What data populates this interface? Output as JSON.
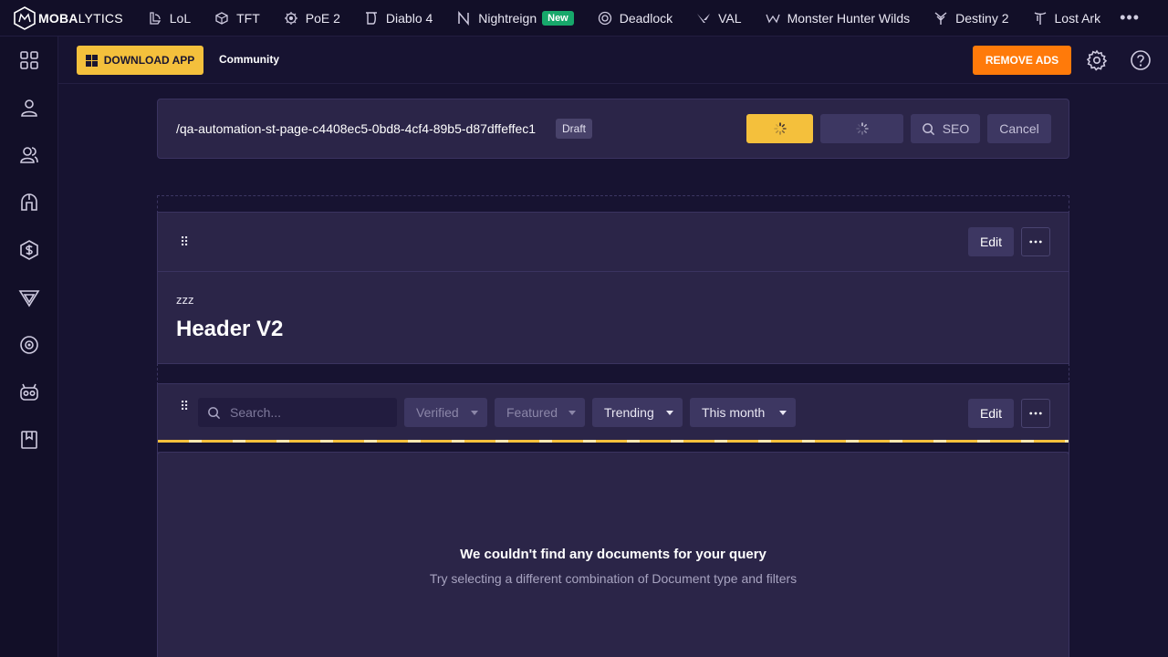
{
  "brand": {
    "bold": "MOBA",
    "light": "LYTICS"
  },
  "games": [
    {
      "label": "LoL",
      "icon": "lol-icon"
    },
    {
      "label": "TFT",
      "icon": "tft-icon"
    },
    {
      "label": "PoE 2",
      "icon": "poe2-icon"
    },
    {
      "label": "Diablo 4",
      "icon": "diablo4-icon"
    },
    {
      "label": "Nightreign",
      "icon": "nightreign-icon",
      "badge": "New"
    },
    {
      "label": "Deadlock",
      "icon": "deadlock-icon"
    },
    {
      "label": "VAL",
      "icon": "valorant-icon"
    },
    {
      "label": "Monster Hunter Wilds",
      "icon": "monster-hunter-icon"
    },
    {
      "label": "Destiny 2",
      "icon": "destiny2-icon"
    },
    {
      "label": "Lost Ark",
      "icon": "lost-ark-icon"
    }
  ],
  "more": "•••",
  "sidebar": [
    "apps-grid-icon",
    "profile-icon",
    "friends-icon",
    "helmet-icon",
    "coin-icon",
    "tft-icon",
    "target-icon",
    "robot-icon",
    "bookmark-icon"
  ],
  "subbar": {
    "download": "DOWNLOAD APP",
    "community": "Community",
    "remove_ads": "REMOVE ADS"
  },
  "page": {
    "path": "/qa-automation-st-page-c4408ec5-0bd8-4cf4-89b5-d87dffeffec1",
    "status": "Draft",
    "seo": "SEO",
    "cancel": "Cancel"
  },
  "header_block": {
    "edit": "Edit",
    "subtitle": "zzz",
    "title": "Header V2"
  },
  "doc_block": {
    "search_placeholder": "Search...",
    "filters": [
      "Verified",
      "Featured",
      "Trending",
      "This month"
    ],
    "edit": "Edit",
    "empty_title": "We couldn't find any documents for your query",
    "empty_sub": "Try selecting a different combination of Document type and filters"
  },
  "colors": {
    "accent": "#f4c03c",
    "orange": "#ff7a0a",
    "bg": "#171331",
    "panel": "#2b2548",
    "new_badge": "#17a86b"
  }
}
